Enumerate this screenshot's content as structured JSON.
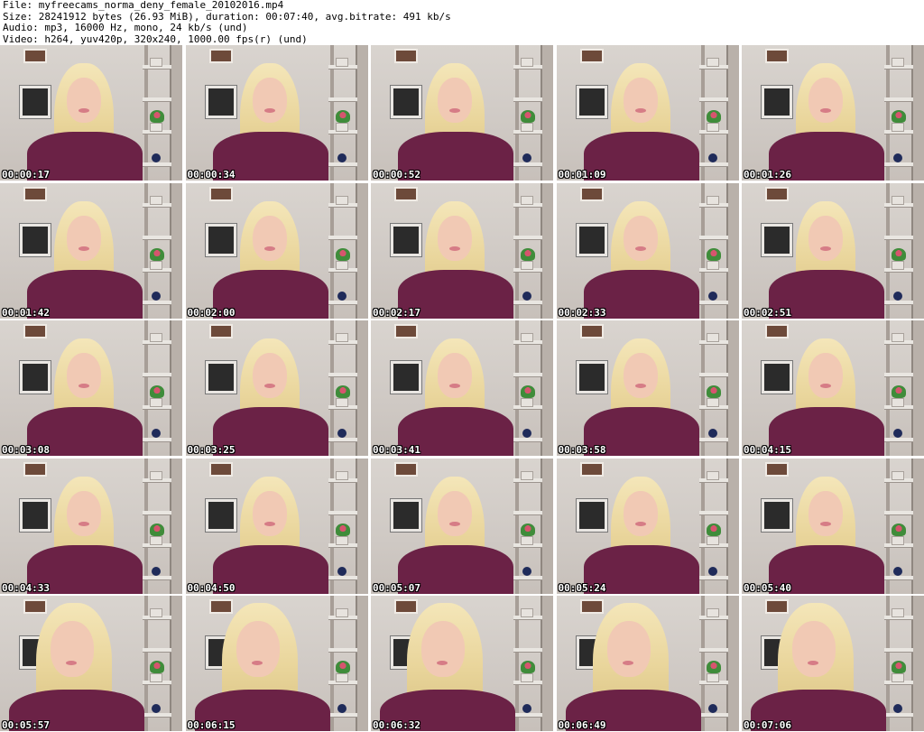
{
  "header": {
    "line1": "File: myfreecams_norma_deny_female_20102016.mp4",
    "line2": "Size: 28241912 bytes (26.93 MiB), duration: 00:07:40, avg.bitrate: 491 kb/s",
    "line3": "Audio: mp3, 16000 Hz, mono, 24 kb/s (und)",
    "line4": "Video: h264, yuv420p, 320x240, 1000.00 fps(r) (und)"
  },
  "thumbnails": [
    {
      "timestamp": "00:00:17"
    },
    {
      "timestamp": "00:00:34"
    },
    {
      "timestamp": "00:00:52"
    },
    {
      "timestamp": "00:01:09"
    },
    {
      "timestamp": "00:01:26"
    },
    {
      "timestamp": "00:01:42"
    },
    {
      "timestamp": "00:02:00"
    },
    {
      "timestamp": "00:02:17"
    },
    {
      "timestamp": "00:02:33"
    },
    {
      "timestamp": "00:02:51"
    },
    {
      "timestamp": "00:03:08"
    },
    {
      "timestamp": "00:03:25"
    },
    {
      "timestamp": "00:03:41"
    },
    {
      "timestamp": "00:03:58"
    },
    {
      "timestamp": "00:04:15"
    },
    {
      "timestamp": "00:04:33"
    },
    {
      "timestamp": "00:04:50"
    },
    {
      "timestamp": "00:05:07"
    },
    {
      "timestamp": "00:05:24"
    },
    {
      "timestamp": "00:05:40"
    },
    {
      "timestamp": "00:05:57",
      "closeup": true
    },
    {
      "timestamp": "00:06:15",
      "closeup": true
    },
    {
      "timestamp": "00:06:32",
      "closeup": true
    },
    {
      "timestamp": "00:06:49",
      "closeup": true
    },
    {
      "timestamp": "00:07:06",
      "closeup": true
    }
  ],
  "colors": {
    "shirt": "#6b2246",
    "hair": "#ecdba6",
    "wall": "#d9d4cf",
    "timestamp_text": "#ffffff"
  }
}
